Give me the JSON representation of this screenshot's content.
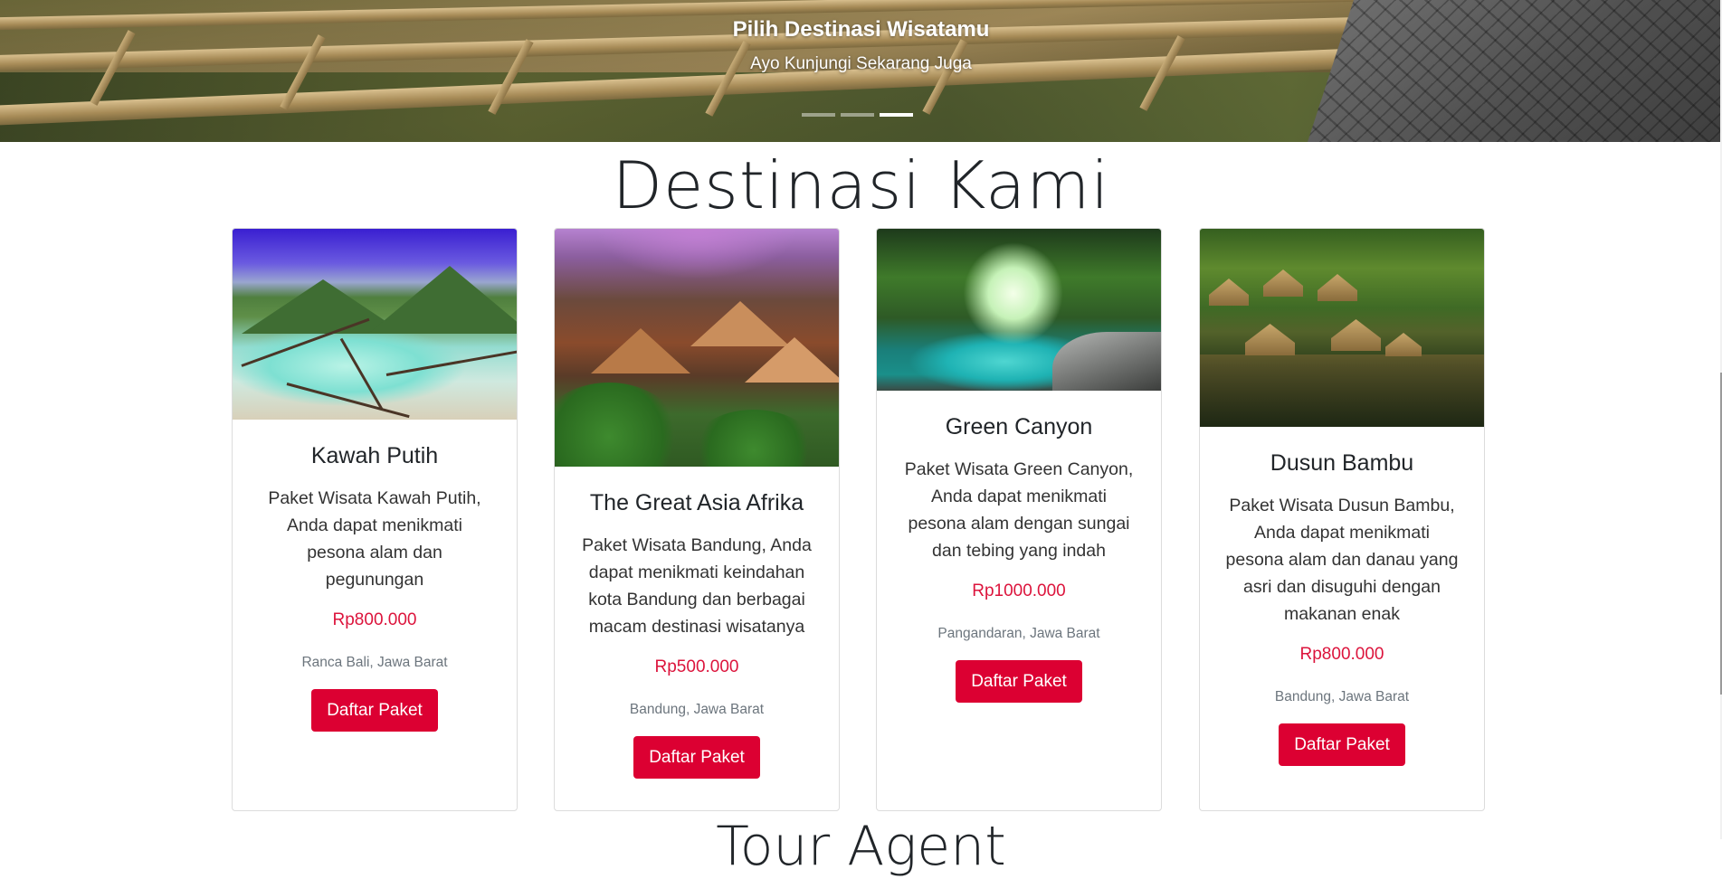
{
  "hero": {
    "title": "Pilih Destinasi Wisatamu",
    "subtitle": "Ayo Kunjungi Sekarang Juga",
    "slides_total": 3,
    "active_slide": 3
  },
  "section": {
    "title": "Destinasi Kami"
  },
  "colors": {
    "accent": "#dc0032",
    "price": "#dc143c",
    "muted": "#6c757d"
  },
  "destinations": [
    {
      "name": "Kawah Putih",
      "description": "Paket Wisata Kawah Putih, Anda dapat menikmati pesona alam dan pegunungan",
      "price": "Rp800.000",
      "location": "Ranca Bali, Jawa Barat",
      "button_label": "Daftar Paket"
    },
    {
      "name": "The Great Asia Afrika",
      "description": "Paket Wisata Bandung, Anda dapat menikmati keindahan kota Bandung dan berbagai macam destinasi wisatanya",
      "price": "Rp500.000",
      "location": "Bandung, Jawa Barat",
      "button_label": "Daftar Paket"
    },
    {
      "name": "Green Canyon",
      "description": "Paket Wisata Green Canyon, Anda dapat menikmati pesona alam dengan sungai dan tebing yang indah",
      "price": "Rp1000.000",
      "location": "Pangandaran, Jawa Barat",
      "button_label": "Daftar Paket"
    },
    {
      "name": "Dusun Bambu",
      "description": "Paket Wisata Dusun Bambu, Anda dapat menikmati pesona alam dan danau yang asri dan disuguhi dengan makanan enak",
      "price": "Rp800.000",
      "location": "Bandung, Jawa Barat",
      "button_label": "Daftar Paket"
    }
  ],
  "next_section": {
    "title_partial": "Tour Agent"
  }
}
